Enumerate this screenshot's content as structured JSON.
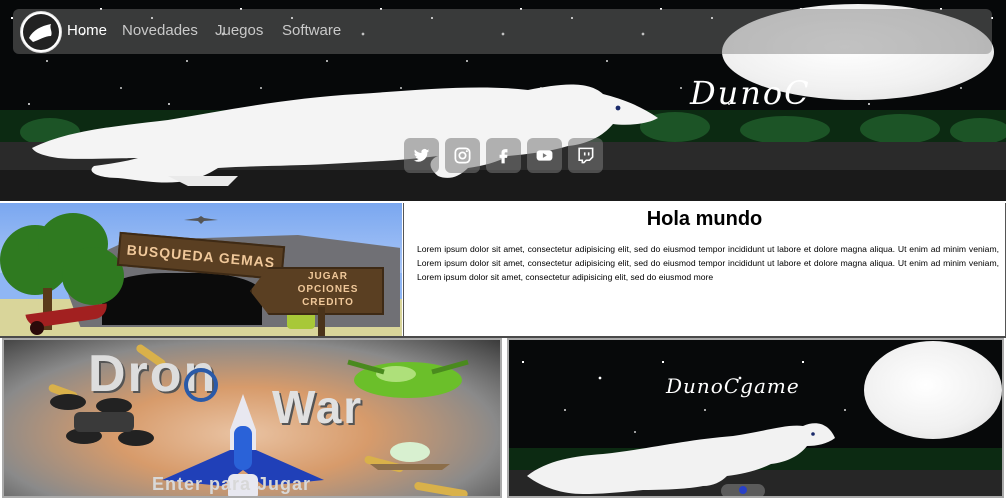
{
  "nav": {
    "logo_icon": "wolf-logo-icon",
    "items": [
      {
        "label": "Home",
        "active": true
      },
      {
        "label": "Novedades",
        "active": false
      },
      {
        "label": "Juegos",
        "active": false
      },
      {
        "label": "Software",
        "active": false
      }
    ]
  },
  "hero": {
    "brand_text": "DunoC",
    "social_icons": [
      "twitter-icon",
      "instagram-icon",
      "facebook-icon",
      "youtube-icon",
      "twitch-icon"
    ]
  },
  "featured_game": {
    "title_sign": "BUSQUEDA GEMAS",
    "menu_options": [
      "JUGAR",
      "OPCIONES",
      "CREDITO"
    ]
  },
  "intro": {
    "heading": "Hola mundo",
    "body": "Lorem ipsum dolor sit amet, consectetur adipisicing elit, sed do eiusmod tempor incididunt ut labore et dolore magna aliqua. Ut enim ad minim veniam, Lorem ipsum dolor sit amet, consectetur adipisicing elit, sed do eiusmod tempor incididunt ut labore et dolore magna aliqua. Ut enim ad minim veniam, Lorem ipsum dolor sit amet, consectetur adipisicing elit, sed do eiusmod more"
  },
  "cards": [
    {
      "title_part1": "Dron",
      "title_part2": "War",
      "cta": "Enter para Jugar"
    },
    {
      "brand_text": "DunoCgame"
    }
  ],
  "colors": {
    "nav_bg": "rgba(120,120,120,0.45)",
    "nav_text": "#c9c9c9",
    "nav_active": "#ffffff",
    "dark_bg": "#060809"
  }
}
